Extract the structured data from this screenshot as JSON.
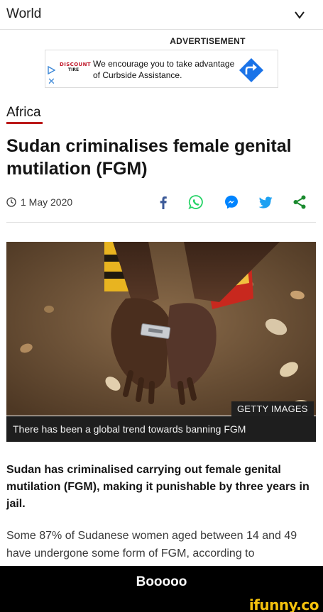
{
  "header": {
    "section": "World"
  },
  "advertisement": {
    "label": "ADVERTISEMENT",
    "logo_line1": "DISCOUNT",
    "logo_line2": "TIRE",
    "text": "We encourage you to take advantage of Curbside Assistance.",
    "close": "✕"
  },
  "article": {
    "category": "Africa",
    "headline": "Sudan criminalises female genital mutilation (FGM)",
    "date": "1 May 2020",
    "image": {
      "credit": "GETTY IMAGES",
      "caption": "There has been a global trend towards banning FGM"
    },
    "intro": "Sudan has criminalised carrying out female genital mutilation (FGM), making it punishable by three years in jail.",
    "body": "Some 87% of Sudanese women aged between 14 and 49 have undergone some form of FGM, according to"
  },
  "share_icons": [
    "facebook-icon",
    "whatsapp-icon",
    "messenger-icon",
    "twitter-icon",
    "share-icon"
  ],
  "meme": {
    "caption": "Booooo",
    "watermark": "ifunny.co"
  },
  "colors": {
    "category_underline": "#bb1919",
    "facebook": "#3b5998",
    "whatsapp": "#25d366",
    "messenger": "#0084ff",
    "twitter": "#1da1f2",
    "share": "#1a8a2e",
    "ad_accent": "#1a73e8",
    "watermark": "#f4c20d"
  }
}
